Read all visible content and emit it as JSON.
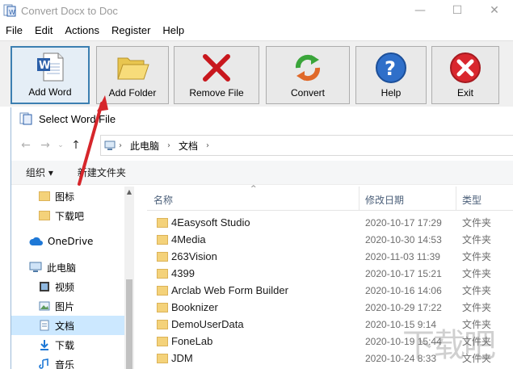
{
  "window": {
    "title": "Convert Docx to Doc",
    "controls": [
      "—",
      "☐",
      "✕"
    ]
  },
  "menu": [
    "File",
    "Edit",
    "Actions",
    "Register",
    "Help"
  ],
  "toolbar": {
    "add_word": "Add Word",
    "add_folder": "Add Folder",
    "remove_file": "Remove File",
    "convert": "Convert",
    "help": "Help",
    "exit": "Exit"
  },
  "dialog": {
    "title": "Select Word File",
    "breadcrumb": [
      "此电脑",
      "文档"
    ],
    "commands": {
      "organize": "组织 ▾",
      "new_folder": "新建文件夹"
    },
    "nav": [
      {
        "label": "图标",
        "icon": "folder-icon"
      },
      {
        "label": "下载吧",
        "icon": "folder-icon"
      },
      {
        "label": "OneDrive",
        "icon": "cloud-icon"
      },
      {
        "label": "此电脑",
        "icon": "computer-icon"
      },
      {
        "label": "视频",
        "icon": "video-icon"
      },
      {
        "label": "图片",
        "icon": "picture-icon"
      },
      {
        "label": "文档",
        "icon": "document-icon"
      },
      {
        "label": "下载",
        "icon": "download-icon"
      },
      {
        "label": "音乐",
        "icon": "music-icon"
      }
    ],
    "columns": {
      "name": "名称",
      "date": "修改日期",
      "type": "类型"
    },
    "files": [
      {
        "name": "4Easysoft Studio",
        "date": "2020-10-17 17:29",
        "type": "文件夹"
      },
      {
        "name": "4Media",
        "date": "2020-10-30 14:53",
        "type": "文件夹"
      },
      {
        "name": "263Vision",
        "date": "2020-11-03 11:39",
        "type": "文件夹"
      },
      {
        "name": "4399",
        "date": "2020-10-17 15:21",
        "type": "文件夹"
      },
      {
        "name": "Arclab Web Form Builder",
        "date": "2020-10-16 14:06",
        "type": "文件夹"
      },
      {
        "name": "Booknizer",
        "date": "2020-10-29 17:22",
        "type": "文件夹"
      },
      {
        "name": "DemoUserData",
        "date": "2020-10-15 9:14",
        "type": "文件夹"
      },
      {
        "name": "FoneLab",
        "date": "2020-10-19 15:44",
        "type": "文件夹"
      },
      {
        "name": "JDM",
        "date": "2020-10-24 8:33",
        "type": "文件夹"
      }
    ]
  },
  "watermark": "下载吧"
}
